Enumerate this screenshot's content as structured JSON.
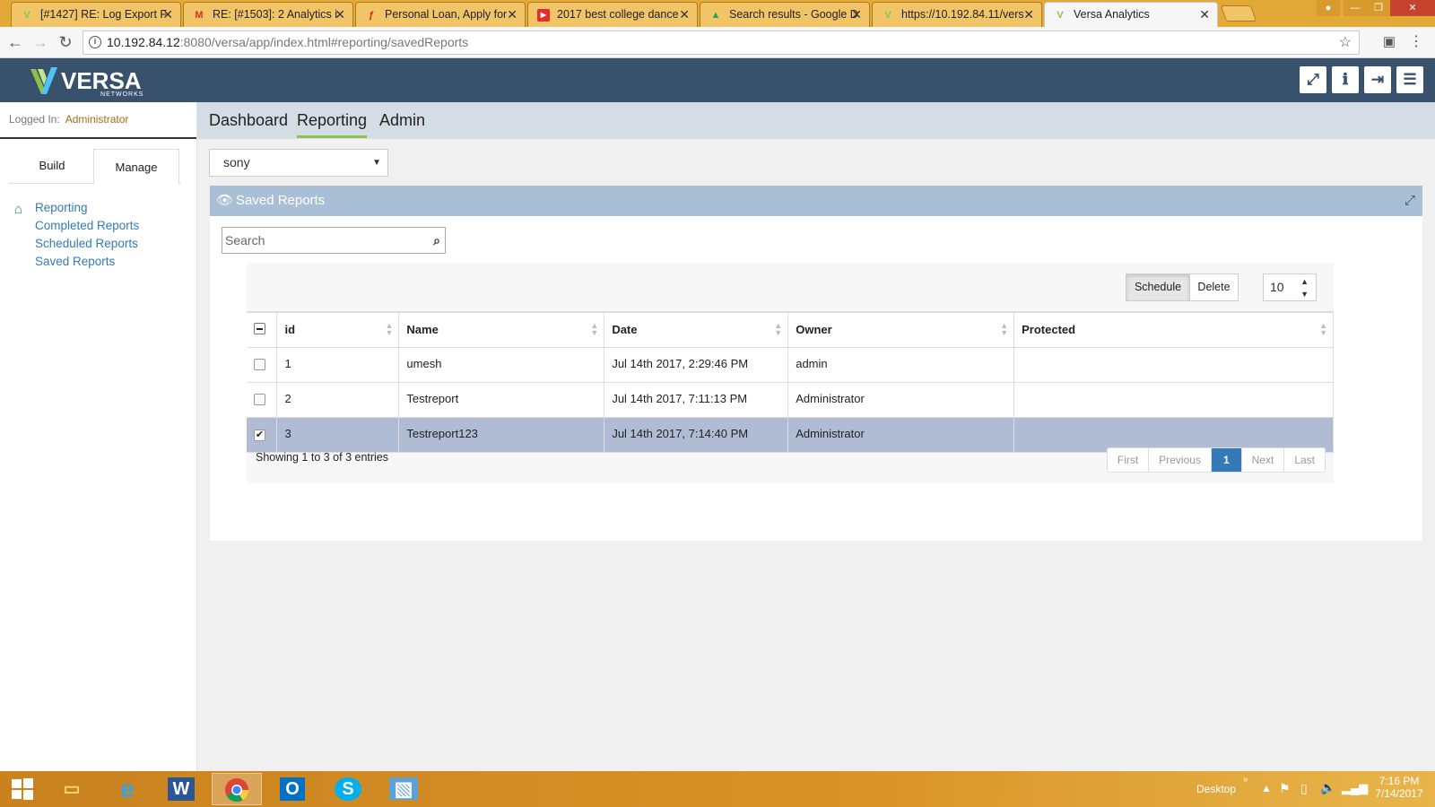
{
  "browser": {
    "tabs": [
      {
        "title": "[#1427] RE: Log Export F",
        "icon": "versa-favicon",
        "color": "#8bc34a"
      },
      {
        "title": "RE: [#1503]: 2 Analytics i",
        "icon": "gmail-favicon",
        "color": "#d93025"
      },
      {
        "title": "Personal Loan, Apply for",
        "icon": "loan-favicon",
        "color": "#c62828"
      },
      {
        "title": "2017 best college dance",
        "icon": "youtube-favicon",
        "color": "#e52d27"
      },
      {
        "title": "Search results - Google D",
        "icon": "google-drive-favicon",
        "color": "#1fa463"
      },
      {
        "title": "https://10.192.84.11/vers",
        "icon": "versa-favicon",
        "color": "#8bc34a"
      },
      {
        "title": "Versa Analytics",
        "icon": "versa-favicon",
        "color": "#8bc34a"
      }
    ],
    "url_host": "10.192.84.12",
    "url_rest": ":8080/versa/app/index.html#reporting/savedReports"
  },
  "app": {
    "logo_word": "VERSA",
    "logo_sub": "NETWORKS",
    "header_buttons": [
      "fullscreen-icon",
      "info-icon",
      "logout-icon",
      "menu-icon"
    ]
  },
  "sidebar": {
    "logged_label": "Logged In:",
    "logged_user": "Administrator",
    "tabs": [
      "Build",
      "Manage"
    ],
    "active_tab": "Manage",
    "root": "Reporting",
    "items": [
      "Completed Reports",
      "Scheduled Reports",
      "Saved Reports"
    ]
  },
  "topnav": {
    "items": [
      "Dashboard",
      "Reporting",
      "Admin"
    ],
    "active": "Reporting"
  },
  "tenant_select": {
    "value": "sony"
  },
  "panel": {
    "title": "Saved Reports",
    "search_placeholder": "Search",
    "schedule_label": "Schedule",
    "delete_label": "Delete",
    "page_size": "10",
    "columns": [
      "id",
      "Name",
      "Date",
      "Owner",
      "Protected"
    ],
    "rows": [
      {
        "id": "1",
        "name": "umesh",
        "date": "Jul 14th 2017, 2:29:46 PM",
        "owner": "admin",
        "protected": "",
        "checked": false
      },
      {
        "id": "2",
        "name": "Testreport",
        "date": "Jul 14th 2017, 7:11:13 PM",
        "owner": "Administrator",
        "protected": "",
        "checked": false
      },
      {
        "id": "3",
        "name": "Testreport123",
        "date": "Jul 14th 2017, 7:14:40 PM",
        "owner": "Administrator",
        "protected": "",
        "checked": true
      }
    ],
    "entries_text": "Showing 1 to 3 of 3 entries",
    "pager": {
      "first": "First",
      "previous": "Previous",
      "current": "1",
      "next": "Next",
      "last": "Last"
    }
  },
  "taskbar": {
    "apps": [
      "file-explorer-icon",
      "internet-explorer-icon",
      "word-icon",
      "chrome-icon",
      "outlook-icon",
      "skype-icon",
      "photos-icon"
    ],
    "desktop_label": "Desktop",
    "time": "7:16 PM",
    "date": "7/14/2017"
  }
}
